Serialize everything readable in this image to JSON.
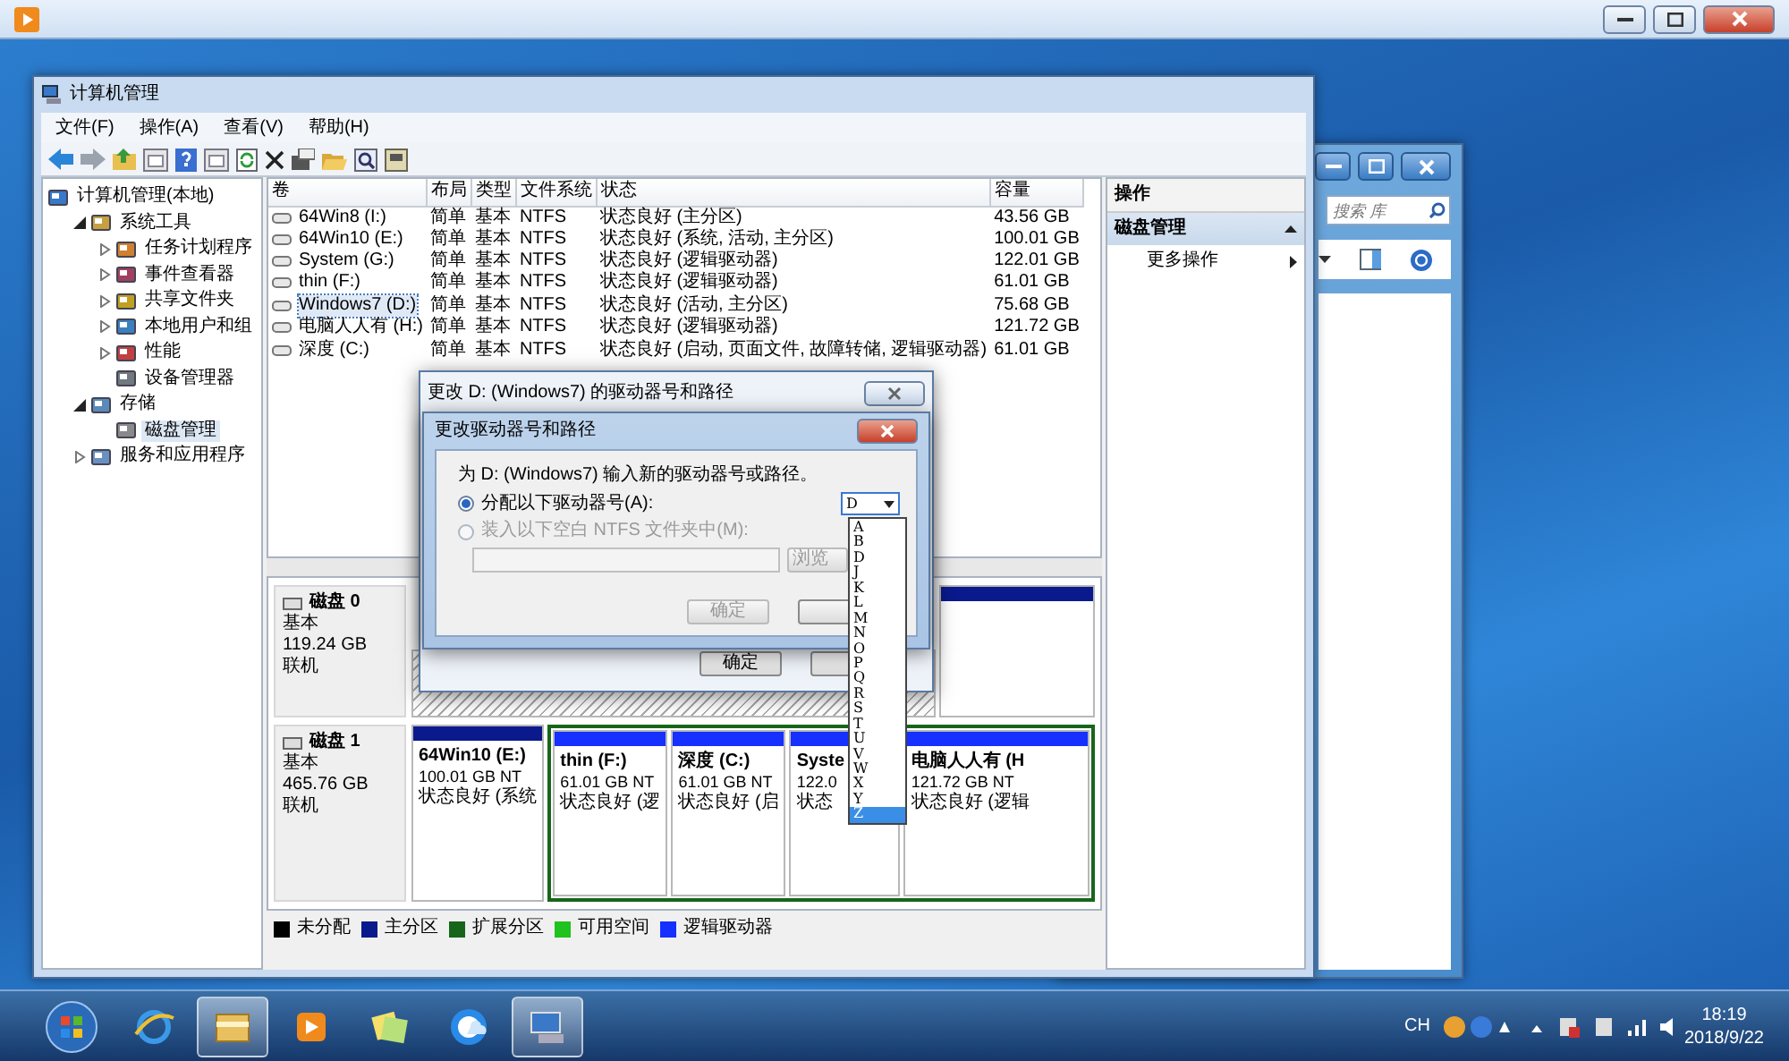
{
  "cm_window": {
    "title": "计算机管理",
    "menu": [
      "文件(F)",
      "操作(A)",
      "查看(V)",
      "帮助(H)"
    ],
    "tree": [
      {
        "label": "计算机管理(本地)",
        "kind": "root",
        "selected": false,
        "children": [
          {
            "label": "系统工具",
            "kind": "branch",
            "expanded": true,
            "selected": false,
            "children": [
              {
                "label": "任务计划程序",
                "kind": "branch",
                "expanded": false,
                "selected": false
              },
              {
                "label": "事件查看器",
                "kind": "branch",
                "expanded": false,
                "selected": false
              },
              {
                "label": "共享文件夹",
                "kind": "branch",
                "expanded": false,
                "selected": false
              },
              {
                "label": "本地用户和组",
                "kind": "branch",
                "expanded": false,
                "selected": false
              },
              {
                "label": "性能",
                "kind": "branch",
                "expanded": false,
                "selected": false
              },
              {
                "label": "设备管理器",
                "kind": "leaf",
                "selected": false
              }
            ]
          },
          {
            "label": "存储",
            "kind": "branch",
            "expanded": true,
            "selected": false,
            "children": [
              {
                "label": "磁盘管理",
                "kind": "leaf",
                "selected": true
              }
            ]
          },
          {
            "label": "服务和应用程序",
            "kind": "branch",
            "expanded": false,
            "selected": false
          }
        ]
      }
    ],
    "volumes": {
      "columns": [
        "卷",
        "布局",
        "类型",
        "文件系统",
        "状态",
        "容量"
      ],
      "rows": [
        {
          "selected": false,
          "cells": [
            "64Win8  (I:)",
            "简单",
            "基本",
            "NTFS",
            "状态良好 (主分区)",
            "43.56 GB"
          ]
        },
        {
          "selected": false,
          "cells": [
            "64Win10 (E:)",
            "简单",
            "基本",
            "NTFS",
            "状态良好 (系统, 活动, 主分区)",
            "100.01 GB"
          ]
        },
        {
          "selected": false,
          "cells": [
            "System (G:)",
            "简单",
            "基本",
            "NTFS",
            "状态良好 (逻辑驱动器)",
            "122.01 GB"
          ]
        },
        {
          "selected": false,
          "cells": [
            "thin (F:)",
            "简单",
            "基本",
            "NTFS",
            "状态良好 (逻辑驱动器)",
            "61.01 GB"
          ]
        },
        {
          "selected": true,
          "cells": [
            "Windows7 (D:)",
            "简单",
            "基本",
            "NTFS",
            "状态良好 (活动, 主分区)",
            "75.68 GB"
          ]
        },
        {
          "selected": false,
          "cells": [
            "电脑人人有 (H:)",
            "简单",
            "基本",
            "NTFS",
            "状态良好 (逻辑驱动器)",
            "121.72 GB"
          ]
        },
        {
          "selected": false,
          "cells": [
            "深度 (C:)",
            "简单",
            "基本",
            "NTFS",
            "状态良好 (启动, 页面文件, 故障转储, 逻辑驱动器)",
            "61.01 GB"
          ]
        }
      ]
    },
    "disks": [
      {
        "name": "磁盘 0",
        "type": "基本",
        "size": "119.24 GB",
        "status": "联机",
        "partitions": [
          {
            "kind": "hatched"
          },
          {
            "kind": "primary"
          }
        ]
      },
      {
        "name": "磁盘 1",
        "type": "基本",
        "size": "465.76 GB",
        "status": "联机",
        "partitions": [
          {
            "kind": "primary",
            "name": "64Win10  (E:)",
            "size": "100.01 GB NT",
            "status": "状态良好 (系统"
          },
          {
            "kind": "logical",
            "name": "thin  (F:)",
            "size": "61.01 GB NT",
            "status": "状态良好 (逻"
          },
          {
            "kind": "logical",
            "name": "深度  (C:)",
            "size": "61.01 GB NT",
            "status": "状态良好 (启"
          },
          {
            "kind": "logical",
            "name": "Syste",
            "size": "122.0",
            "status": "状态"
          },
          {
            "kind": "logical",
            "name": "电脑人人有  (H",
            "size": "121.72 GB NT",
            "status": "状态良好 (逻辑"
          }
        ]
      }
    ],
    "legend": [
      {
        "label": "未分配",
        "color": "#000000"
      },
      {
        "label": "主分区",
        "color": "#0a1a8c"
      },
      {
        "label": "扩展分区",
        "color": "#16661a"
      },
      {
        "label": "可用空间",
        "color": "#1fc21f"
      },
      {
        "label": "逻辑驱动器",
        "color": "#1530ff"
      }
    ],
    "actions": {
      "header": "操作",
      "items": [
        {
          "kind": "group",
          "label": "磁盘管理",
          "expanded": true
        },
        {
          "kind": "link",
          "label": "更多操作"
        }
      ]
    }
  },
  "explorer_window": {
    "search_placeholder": "搜索 库"
  },
  "outer_dialog": {
    "title": "更改 D: (Windows7) 的驱动器号和路径",
    "ok": "确定"
  },
  "dialog": {
    "title": "更改驱动器号和路径",
    "prompt": "为 D: (Windows7) 输入新的驱动器号或路径。",
    "options": [
      {
        "label": "分配以下驱动器号(A):",
        "selected": true,
        "disabled": false
      },
      {
        "label": "装入以下空白 NTFS 文件夹中(M):",
        "selected": false,
        "disabled": true
      }
    ],
    "drive_value": "D",
    "browse": "浏览",
    "ok": "确定",
    "ok_disabled": true,
    "letters": [
      {
        "label": "A",
        "selected": false
      },
      {
        "label": "B",
        "selected": false
      },
      {
        "label": "D",
        "selected": false
      },
      {
        "label": "J",
        "selected": false
      },
      {
        "label": "K",
        "selected": false
      },
      {
        "label": "L",
        "selected": false
      },
      {
        "label": "M",
        "selected": false
      },
      {
        "label": "N",
        "selected": false
      },
      {
        "label": "O",
        "selected": false
      },
      {
        "label": "P",
        "selected": false
      },
      {
        "label": "Q",
        "selected": false
      },
      {
        "label": "R",
        "selected": false
      },
      {
        "label": "S",
        "selected": false
      },
      {
        "label": "T",
        "selected": false
      },
      {
        "label": "U",
        "selected": false
      },
      {
        "label": "V",
        "selected": false
      },
      {
        "label": "W",
        "selected": false
      },
      {
        "label": "X",
        "selected": false
      },
      {
        "label": "Y",
        "selected": false
      },
      {
        "label": "Z",
        "selected": true
      }
    ]
  },
  "taskbar": {
    "apps": [
      {
        "kind": "ie",
        "active": false
      },
      {
        "kind": "folder",
        "active": true
      },
      {
        "kind": "media",
        "active": false
      },
      {
        "kind": "notes",
        "active": false
      },
      {
        "kind": "cloud",
        "active": false
      },
      {
        "kind": "manager",
        "active": true
      }
    ],
    "language": "CH",
    "time": "18:19",
    "date": "2018/9/22"
  }
}
